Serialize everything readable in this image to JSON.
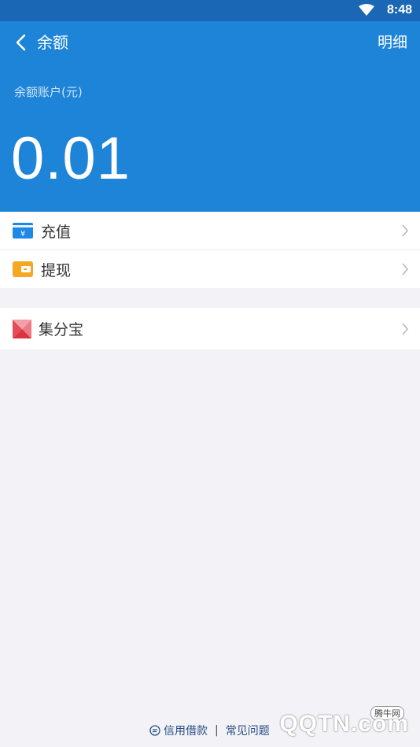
{
  "status_bar": {
    "time": "8:48"
  },
  "header": {
    "title": "余额",
    "detail_label": "明细",
    "balance_label": "余额账户(元)",
    "balance_value": "0.01"
  },
  "actions": [
    {
      "label": "充值",
      "icon": "recharge-icon",
      "color": "#1e88e5"
    },
    {
      "label": "提现",
      "icon": "withdraw-icon",
      "color": "#f5a623"
    }
  ],
  "extras": [
    {
      "label": "集分宝",
      "icon": "jifenbao-icon",
      "color": "#e64b57"
    }
  ],
  "footer": {
    "link1": "信用借款",
    "separator": "|",
    "link2": "常见问题"
  },
  "watermark": {
    "text": "QQTN.com",
    "badge": "腾牛网"
  }
}
